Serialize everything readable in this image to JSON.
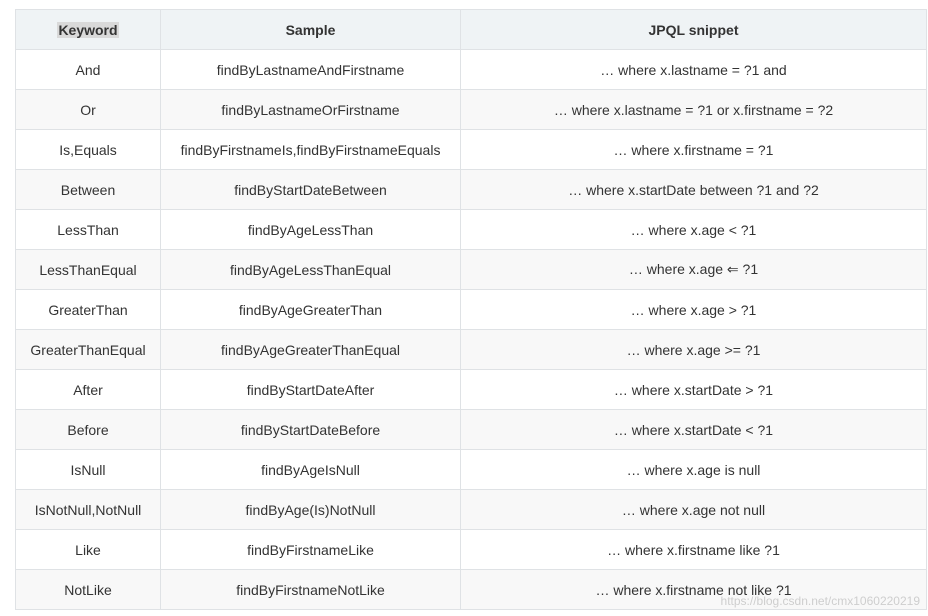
{
  "table": {
    "headers": [
      "Keyword",
      "Sample",
      "JPQL snippet"
    ],
    "rows": [
      [
        "And",
        "findByLastnameAndFirstname",
        "… where x.lastname = ?1 and"
      ],
      [
        "Or",
        "findByLastnameOrFirstname",
        "… where x.lastname = ?1 or x.firstname = ?2"
      ],
      [
        "Is,Equals",
        "findByFirstnameIs,findByFirstnameEquals",
        "… where x.firstname = ?1"
      ],
      [
        "Between",
        "findByStartDateBetween",
        "… where x.startDate between ?1 and ?2"
      ],
      [
        "LessThan",
        "findByAgeLessThan",
        "… where x.age < ?1"
      ],
      [
        "LessThanEqual",
        "findByAgeLessThanEqual",
        "… where x.age ⇐ ?1"
      ],
      [
        "GreaterThan",
        "findByAgeGreaterThan",
        "… where x.age > ?1"
      ],
      [
        "GreaterThanEqual",
        "findByAgeGreaterThanEqual",
        "… where x.age >= ?1"
      ],
      [
        "After",
        "findByStartDateAfter",
        "… where x.startDate > ?1"
      ],
      [
        "Before",
        "findByStartDateBefore",
        "… where x.startDate < ?1"
      ],
      [
        "IsNull",
        "findByAgeIsNull",
        "… where x.age is null"
      ],
      [
        "IsNotNull,NotNull",
        "findByAge(Is)NotNull",
        "… where x.age not null"
      ],
      [
        "Like",
        "findByFirstnameLike",
        "… where x.firstname like ?1"
      ],
      [
        "NotLike",
        "findByFirstnameNotLike",
        "… where x.firstname not like ?1"
      ]
    ]
  },
  "watermark": "https://blog.csdn.net/cmx1060220219"
}
